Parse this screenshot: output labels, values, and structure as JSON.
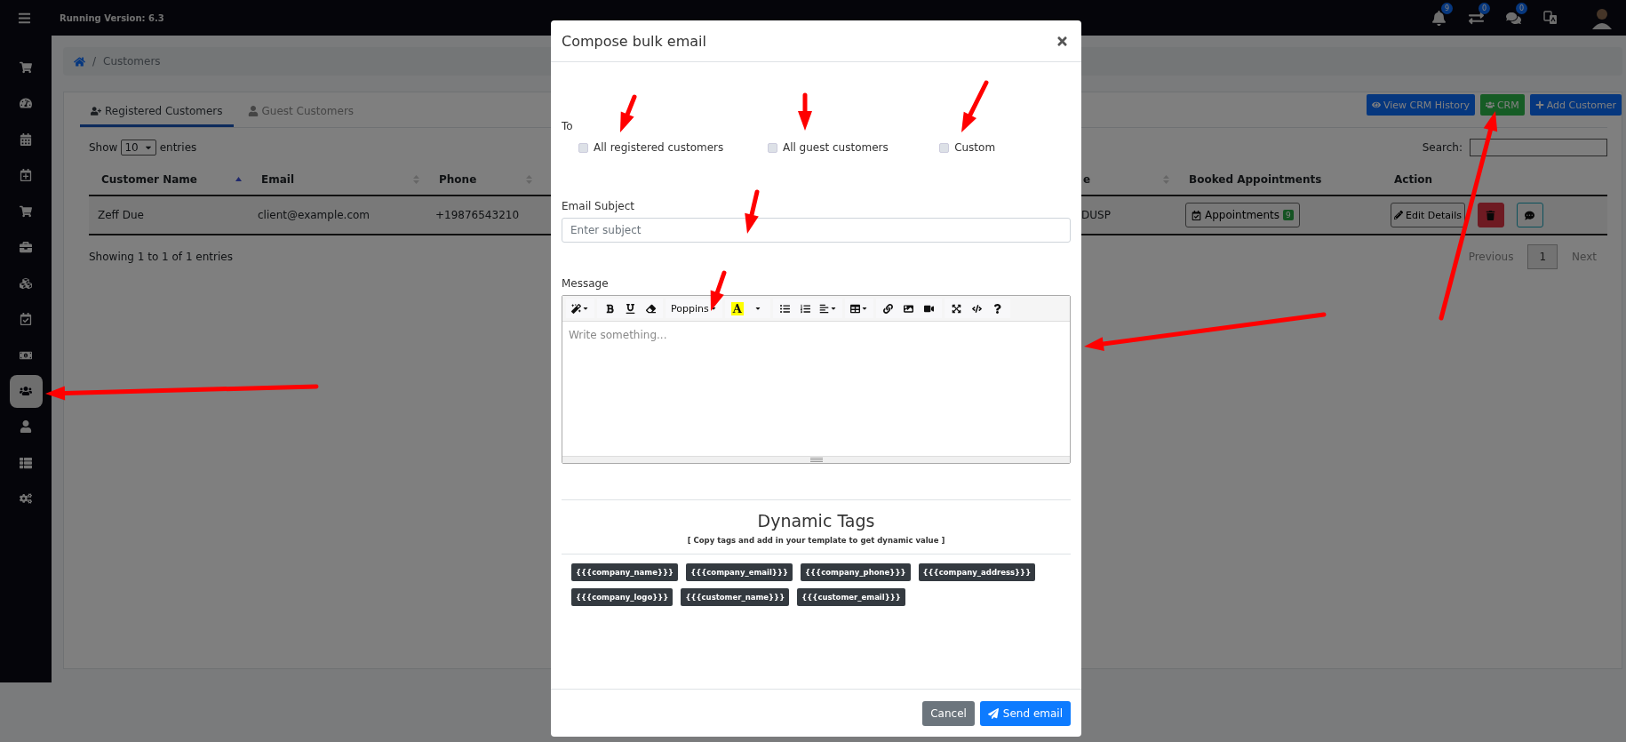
{
  "topbar": {
    "version": "Running Version: 6.3",
    "badges": [
      {
        "count": "9"
      },
      {
        "count": "0"
      },
      {
        "count": "0"
      }
    ]
  },
  "sidebar": {
    "items": [
      {
        "selected": false
      },
      {
        "selected": false
      },
      {
        "selected": false
      },
      {
        "selected": false
      },
      {
        "selected": false
      },
      {
        "selected": false
      },
      {
        "selected": false
      },
      {
        "selected": false
      },
      {
        "selected": false
      },
      {
        "selected": true
      },
      {
        "selected": false
      },
      {
        "selected": false
      },
      {
        "selected": false
      }
    ]
  },
  "breadcrumb": {
    "separator": "/",
    "current": "Customers"
  },
  "tabs": [
    {
      "label": "Registered Customers",
      "selected": true
    },
    {
      "label": "Guest Customers",
      "selected": false
    }
  ],
  "actions": [
    {
      "label": "View CRM History",
      "kind": "primary"
    },
    {
      "label": "CRM",
      "kind": "success"
    },
    {
      "label": "Add Customer",
      "kind": "primary"
    }
  ],
  "table": {
    "show": "Show",
    "page_size": "10",
    "entries": "entries",
    "search_label": "Search:",
    "columns": [
      {
        "label": "Customer Name",
        "sorted": true
      },
      {
        "label": "Email",
        "sorted": false
      },
      {
        "label": "Phone",
        "sorted": false
      },
      {
        "label": "e",
        "sorted": false
      },
      {
        "label": "Booked Appointments"
      },
      {
        "label": "Action"
      }
    ],
    "rows": [
      {
        "cells": [
          "Zeff Due",
          "client@example.com",
          "+19876543210",
          "DUSP"
        ],
        "appointments": "Appointments",
        "appointment_count": "9",
        "edit": "Edit Details"
      }
    ],
    "info": "Showing 1 to 1 of 1 entries",
    "pagination": [
      {
        "label": "Previous",
        "selected": false
      },
      {
        "label": "1",
        "selected": true
      },
      {
        "label": "Next",
        "selected": false
      }
    ]
  },
  "modal": {
    "title": "Compose bulk email",
    "to_label": "To",
    "recipients": [
      {
        "label": "All registered customers",
        "checked": false
      },
      {
        "label": "All guest customers",
        "checked": false
      },
      {
        "label": "Custom",
        "checked": false
      }
    ],
    "subject_label": "Email Subject",
    "subject_placeholder": "Enter subject",
    "message_label": "Message",
    "font": "Poppins",
    "color_letter": "A",
    "editor_placeholder": "Write something...",
    "tags_title": "Dynamic Tags",
    "tags_hint": "[ Copy tags and add in your template to get dynamic value ]",
    "tags": [
      "{{{company_name}}}",
      "{{{company_email}}}",
      "{{{company_phone}}}",
      "{{{company_address}}}",
      "{{{company_logo}}}",
      "{{{customer_name}}}",
      "{{{customer_email}}}"
    ],
    "cancel": "Cancel",
    "send": "Send email"
  }
}
